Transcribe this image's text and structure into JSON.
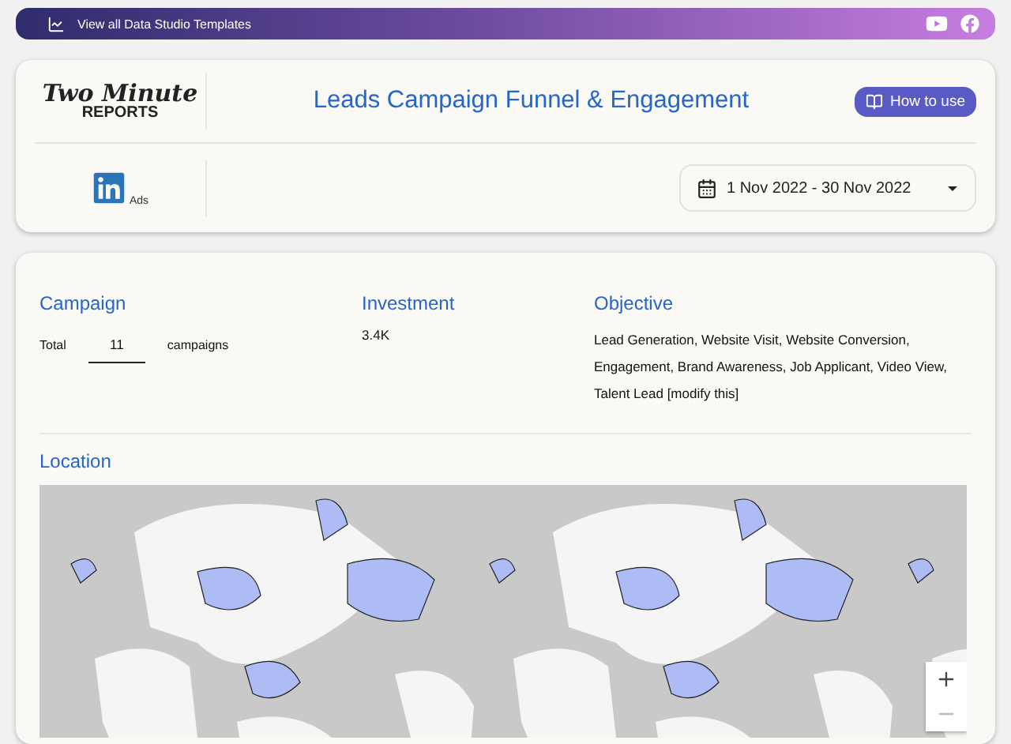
{
  "banner": {
    "link": "View all Data Studio Templates"
  },
  "header": {
    "logo": {
      "line_1": "Two Minute",
      "line_2": "REPORTS"
    },
    "title": "Leads Campaign Funnel & Engagement",
    "help_button": "How to use",
    "platform_label": "Ads",
    "date_range": "1 Nov 2022 - 30 Nov 2022"
  },
  "summary": {
    "campaign": {
      "heading": "Campaign",
      "prefix": "Total",
      "count": "11",
      "suffix": "campaigns"
    },
    "investment": {
      "heading": "Investment",
      "value": "3.4K"
    },
    "objective": {
      "heading": "Objective",
      "value": "Lead Generation, Website Visit, Website Conversion, Engagement, Brand Awareness, Job Applicant, Video View, Talent Lead [modify this]"
    }
  },
  "location": {
    "heading": "Location"
  }
}
